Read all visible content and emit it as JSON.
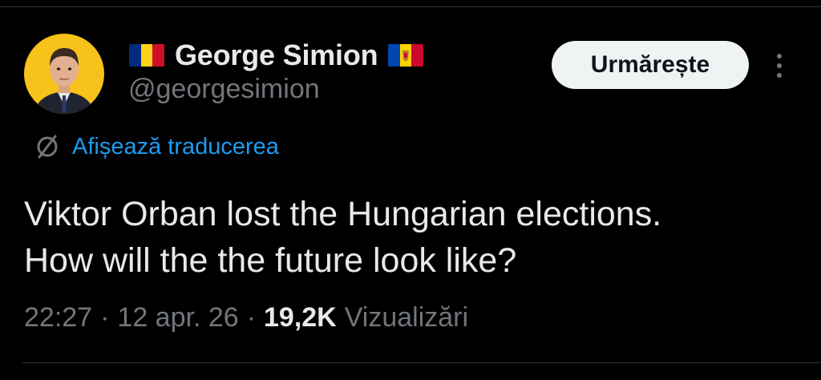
{
  "tweet": {
    "author": {
      "display_name": "George Simion",
      "handle": "@georgesimion",
      "avatar_icon": "avatar-photo",
      "flag_left": "romania-flag",
      "flag_right": "moldova-flag"
    },
    "follow_label": "Urmărește",
    "more_icon": "more-vertical-icon",
    "translate": {
      "icon": "globe-translate-icon",
      "label": "Afișează traducerea"
    },
    "text_lines": [
      "Viktor Orban lost the Hungarian elections.",
      "How will the the future look like?"
    ],
    "meta": {
      "time": "22:27",
      "separator": "·",
      "date": "12 apr. 26",
      "views_count": "19,2K",
      "views_label": "Vizualizări"
    }
  },
  "colors": {
    "background": "#000000",
    "primary_text": "#e7e9ea",
    "secondary_text": "#71767b",
    "link_blue": "#1d9bf0",
    "button_bg": "#eff3f4",
    "button_text": "#0f1419",
    "avatar_bg": "#f7c21a"
  }
}
